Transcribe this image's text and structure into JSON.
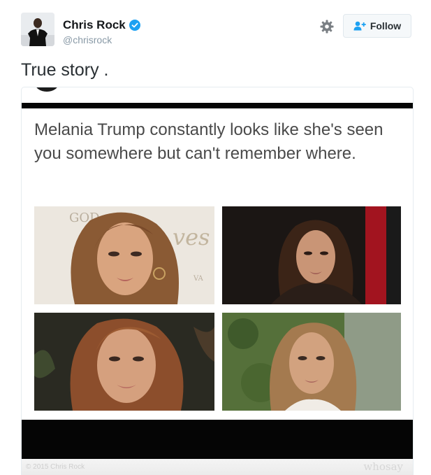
{
  "tweet": {
    "display_name": "Chris Rock",
    "handle": "@chrisrock",
    "text": "True story .",
    "follow_label": "Follow",
    "verified_icon": "verified-badge-icon",
    "settings_icon": "gear-icon",
    "follow_icon": "add-user-icon"
  },
  "meme": {
    "caption": "Melania Trump constantly looks like she's seen you somewhere but can't remember where.",
    "copyright": "© 2015 Chris Rock",
    "watermark": "whosay",
    "photo_text_1": "GOD",
    "photo_text_2": "ves",
    "photo_text_3": "VA"
  },
  "colors": {
    "accent": "#1da1f2",
    "text": "#14171a",
    "muted": "#8899a6",
    "bar": "#050505"
  }
}
